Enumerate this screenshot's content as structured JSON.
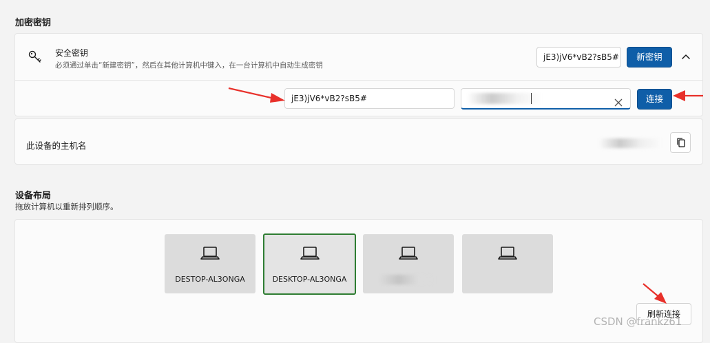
{
  "encryption": {
    "section_title": "加密密钥",
    "security_key_title": "安全密钥",
    "security_key_desc": "必须通过单击“新建密钥”，然后在其他计算机中键入，在一台计算机中自动生成密钥",
    "current_key": "jE3)jV6*vB2?sB5#",
    "new_key_label": "新密钥",
    "key_input_value": "jE3)jV6*vB2?sB5#",
    "connect_label": "连接"
  },
  "hostname": {
    "label": "此设备的主机名"
  },
  "layout": {
    "section_title": "设备布局",
    "subtitle": "拖放计算机以重新排列顺序。",
    "devices": [
      {
        "name": "DESTOP-AL3ONGA",
        "selected": false
      },
      {
        "name": "DESKTOP-AL3ONGA",
        "selected": true
      },
      {
        "name": "",
        "selected": false
      },
      {
        "name": "",
        "selected": false
      }
    ],
    "refresh_label": "刷新连接"
  },
  "watermark": "CSDN @frankz61",
  "colors": {
    "accent": "#0f5ea8",
    "selected_border": "#2e7d32",
    "arrow": "#e8302a"
  },
  "icons": [
    "key-icon",
    "chevron-up-icon",
    "clear-icon",
    "copy-icon",
    "laptop-icon"
  ]
}
